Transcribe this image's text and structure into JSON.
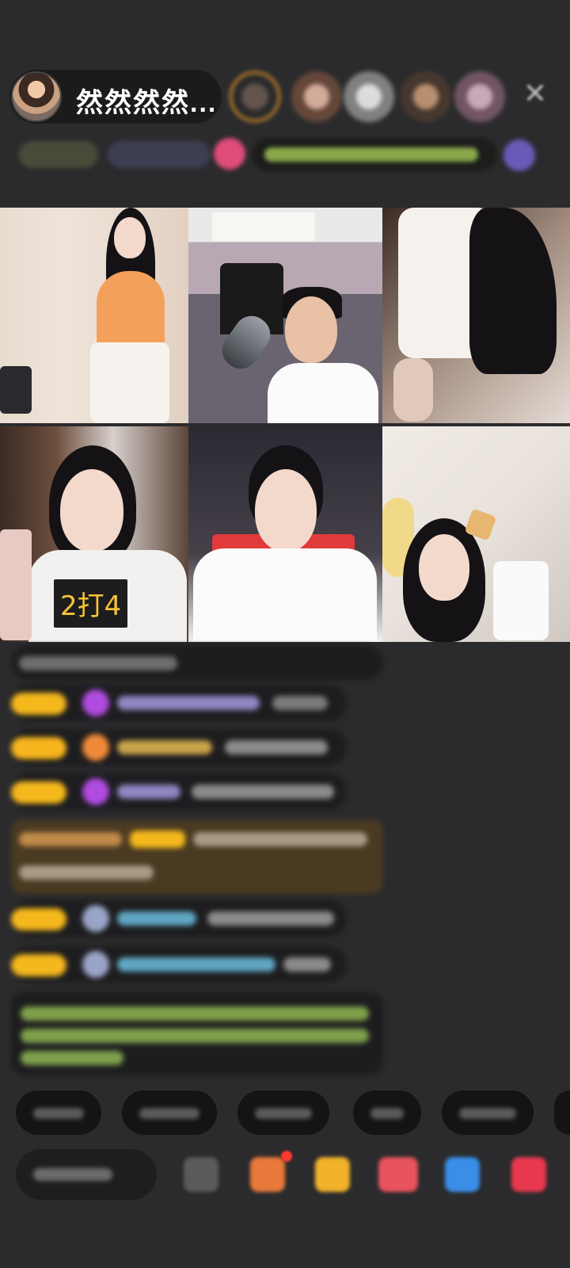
{
  "header": {
    "host_name": "然然然然..."
  },
  "grid": {
    "tile_badge": "2打4"
  },
  "icons": {
    "close": "close-icon",
    "gift": "gift-icon",
    "emoji": "emoji-icon"
  },
  "colors": {
    "background": "#2b2b2d",
    "level_badge": "#f5b81c",
    "badge_text": "#f6c23a"
  }
}
